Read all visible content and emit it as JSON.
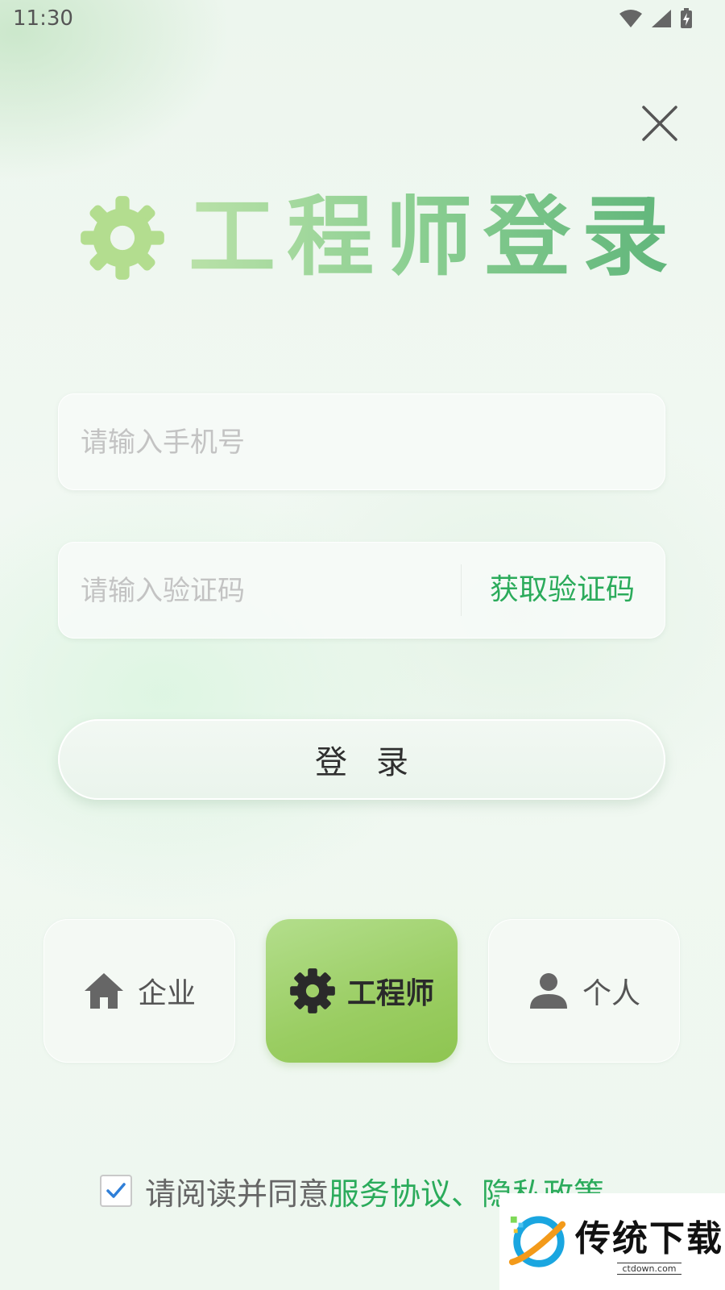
{
  "status_bar": {
    "time": "11:30",
    "icons": [
      "wifi-icon",
      "signal-icon",
      "battery-charging-icon"
    ]
  },
  "header": {
    "close_icon": "close-icon"
  },
  "title": {
    "icon": "gear-icon",
    "text": "工程师登录"
  },
  "form": {
    "phone_placeholder": "请输入手机号",
    "phone_value": "",
    "code_placeholder": "请输入验证码",
    "code_value": "",
    "get_code_label": "获取验证码"
  },
  "login_button_label": "登录",
  "roles": [
    {
      "label": "企业",
      "icon": "home-icon",
      "selected": false
    },
    {
      "label": "工程师",
      "icon": "gear-icon",
      "selected": true
    },
    {
      "label": "个人",
      "icon": "person-icon",
      "selected": false
    }
  ],
  "agreement": {
    "checked": true,
    "prefix": "请阅读并同意",
    "terms_link": "服务协议",
    "separator": "、",
    "privacy_link": "隐私政策"
  },
  "watermark": {
    "title": "传统下载",
    "subtitle": "ctdown.com"
  },
  "colors": {
    "accent_green": "#2bab5b",
    "engineer_card": "#9acd62",
    "title_start": "#b9e1a8",
    "title_end": "#5fb57a"
  }
}
